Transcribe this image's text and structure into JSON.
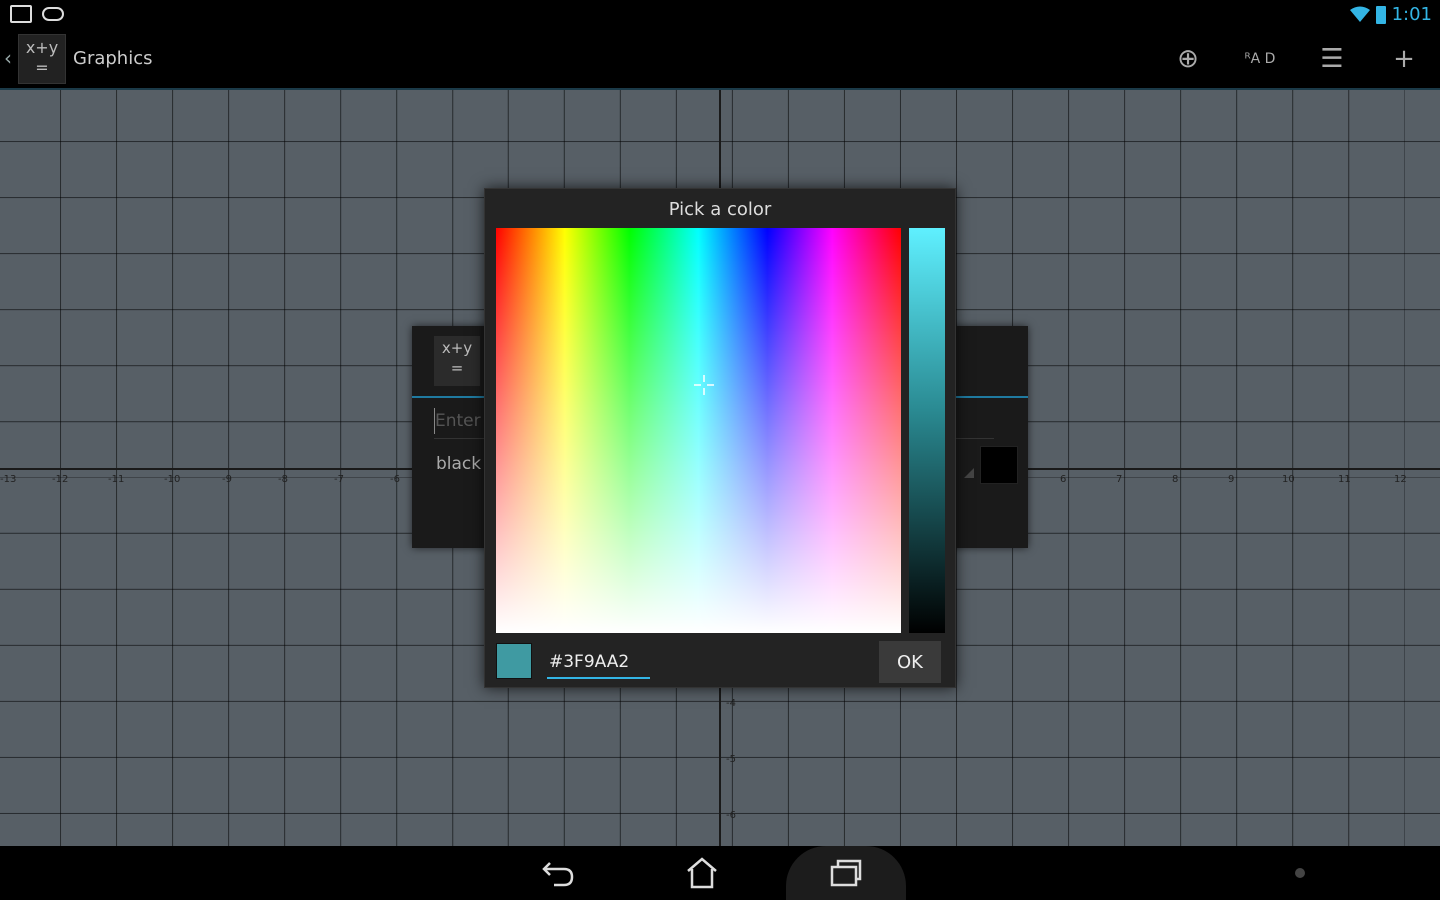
{
  "status_bar": {
    "time": "1:01",
    "left_icons": [
      "picture-icon",
      "game-controller-icon"
    ],
    "right_icons": [
      "wifi-icon",
      "battery-icon"
    ],
    "accent_color": "#33b5e5"
  },
  "action_bar": {
    "logo_text_top": "x+y",
    "logo_text_bottom": "=",
    "title": "Graphics",
    "actions": [
      {
        "name": "add-circle-icon",
        "glyph": "⊕"
      },
      {
        "name": "rad-deg-icon",
        "glyph": "ᴿA D"
      },
      {
        "name": "list-icon",
        "glyph": "☰"
      },
      {
        "name": "add-icon",
        "glyph": "+"
      }
    ]
  },
  "graph": {
    "x_ticks_left": [
      "-13",
      "-12",
      "-11",
      "-10",
      "-9",
      "-8",
      "-7",
      "-6"
    ],
    "x_ticks_right": [
      "6",
      "7",
      "8",
      "9",
      "10",
      "11",
      "12"
    ],
    "y_ticks_below": [
      "-4",
      "-5",
      "-6"
    ]
  },
  "formula_panel": {
    "logo_text_top": "x+y",
    "logo_text_bottom": "=",
    "input_placeholder": "Enter",
    "color_label": "black"
  },
  "color_dialog": {
    "title": "Pick a color",
    "hex_value": "#3F9AA2",
    "selected_color": "#3F9AA2",
    "ok_label": "OK"
  },
  "nav_bar": {
    "buttons": [
      "back-icon",
      "home-icon",
      "recent-apps-icon"
    ]
  }
}
